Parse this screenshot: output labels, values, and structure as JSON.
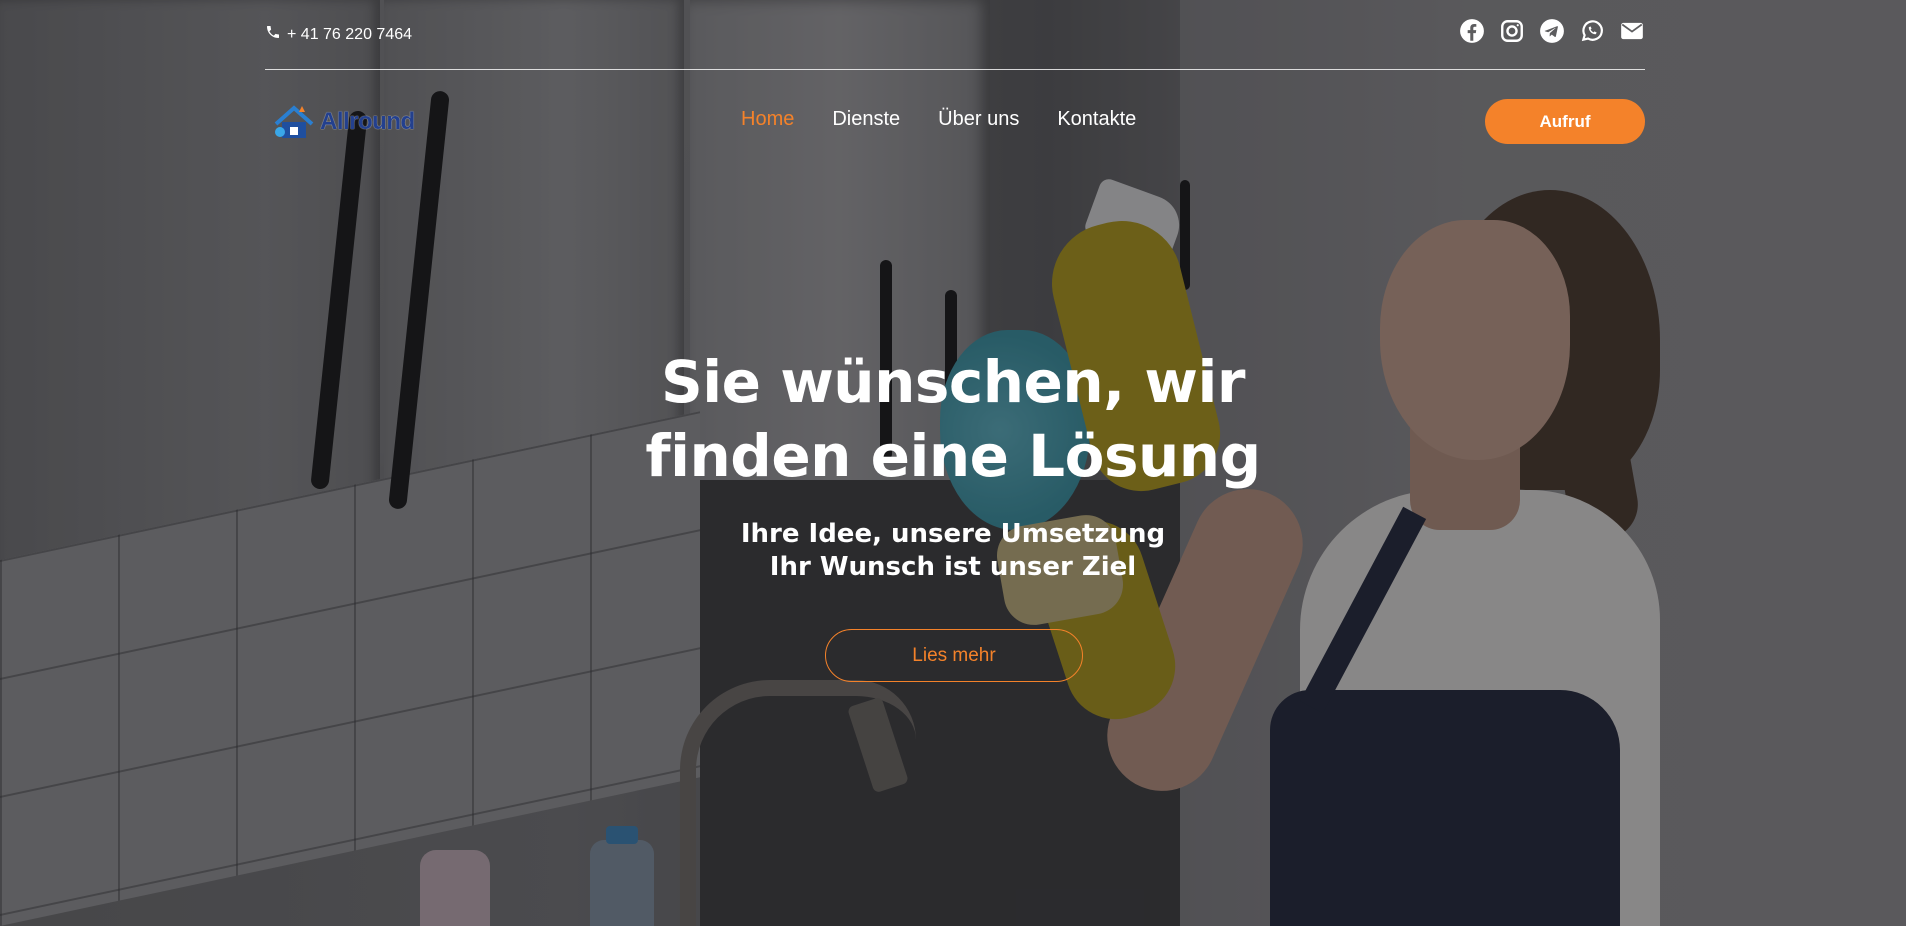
{
  "topbar": {
    "phone_icon": "phone-icon",
    "phone": "+ 41 76 220 7464",
    "socials": [
      "facebook-icon",
      "instagram-icon",
      "telegram-icon",
      "whatsapp-icon",
      "envelope-icon"
    ]
  },
  "logo": {
    "text": "Allround"
  },
  "nav": {
    "items": [
      {
        "label": "Home",
        "active": true
      },
      {
        "label": "Dienste",
        "active": false
      },
      {
        "label": "Über uns",
        "active": false
      },
      {
        "label": "Kontakte",
        "active": false
      }
    ],
    "cta_label": "Aufruf"
  },
  "hero": {
    "headline_line1": "Sie wünschen, wir",
    "headline_line2": "finden eine Lösung",
    "sub_line1": "Ihre Idee, unsere Umsetzung",
    "sub_line2": "Ihr Wunsch ist unser Ziel",
    "button_label": "Lies mehr"
  },
  "colors": {
    "accent": "#f4822a",
    "text": "#ffffff",
    "logo": "#23408e"
  }
}
